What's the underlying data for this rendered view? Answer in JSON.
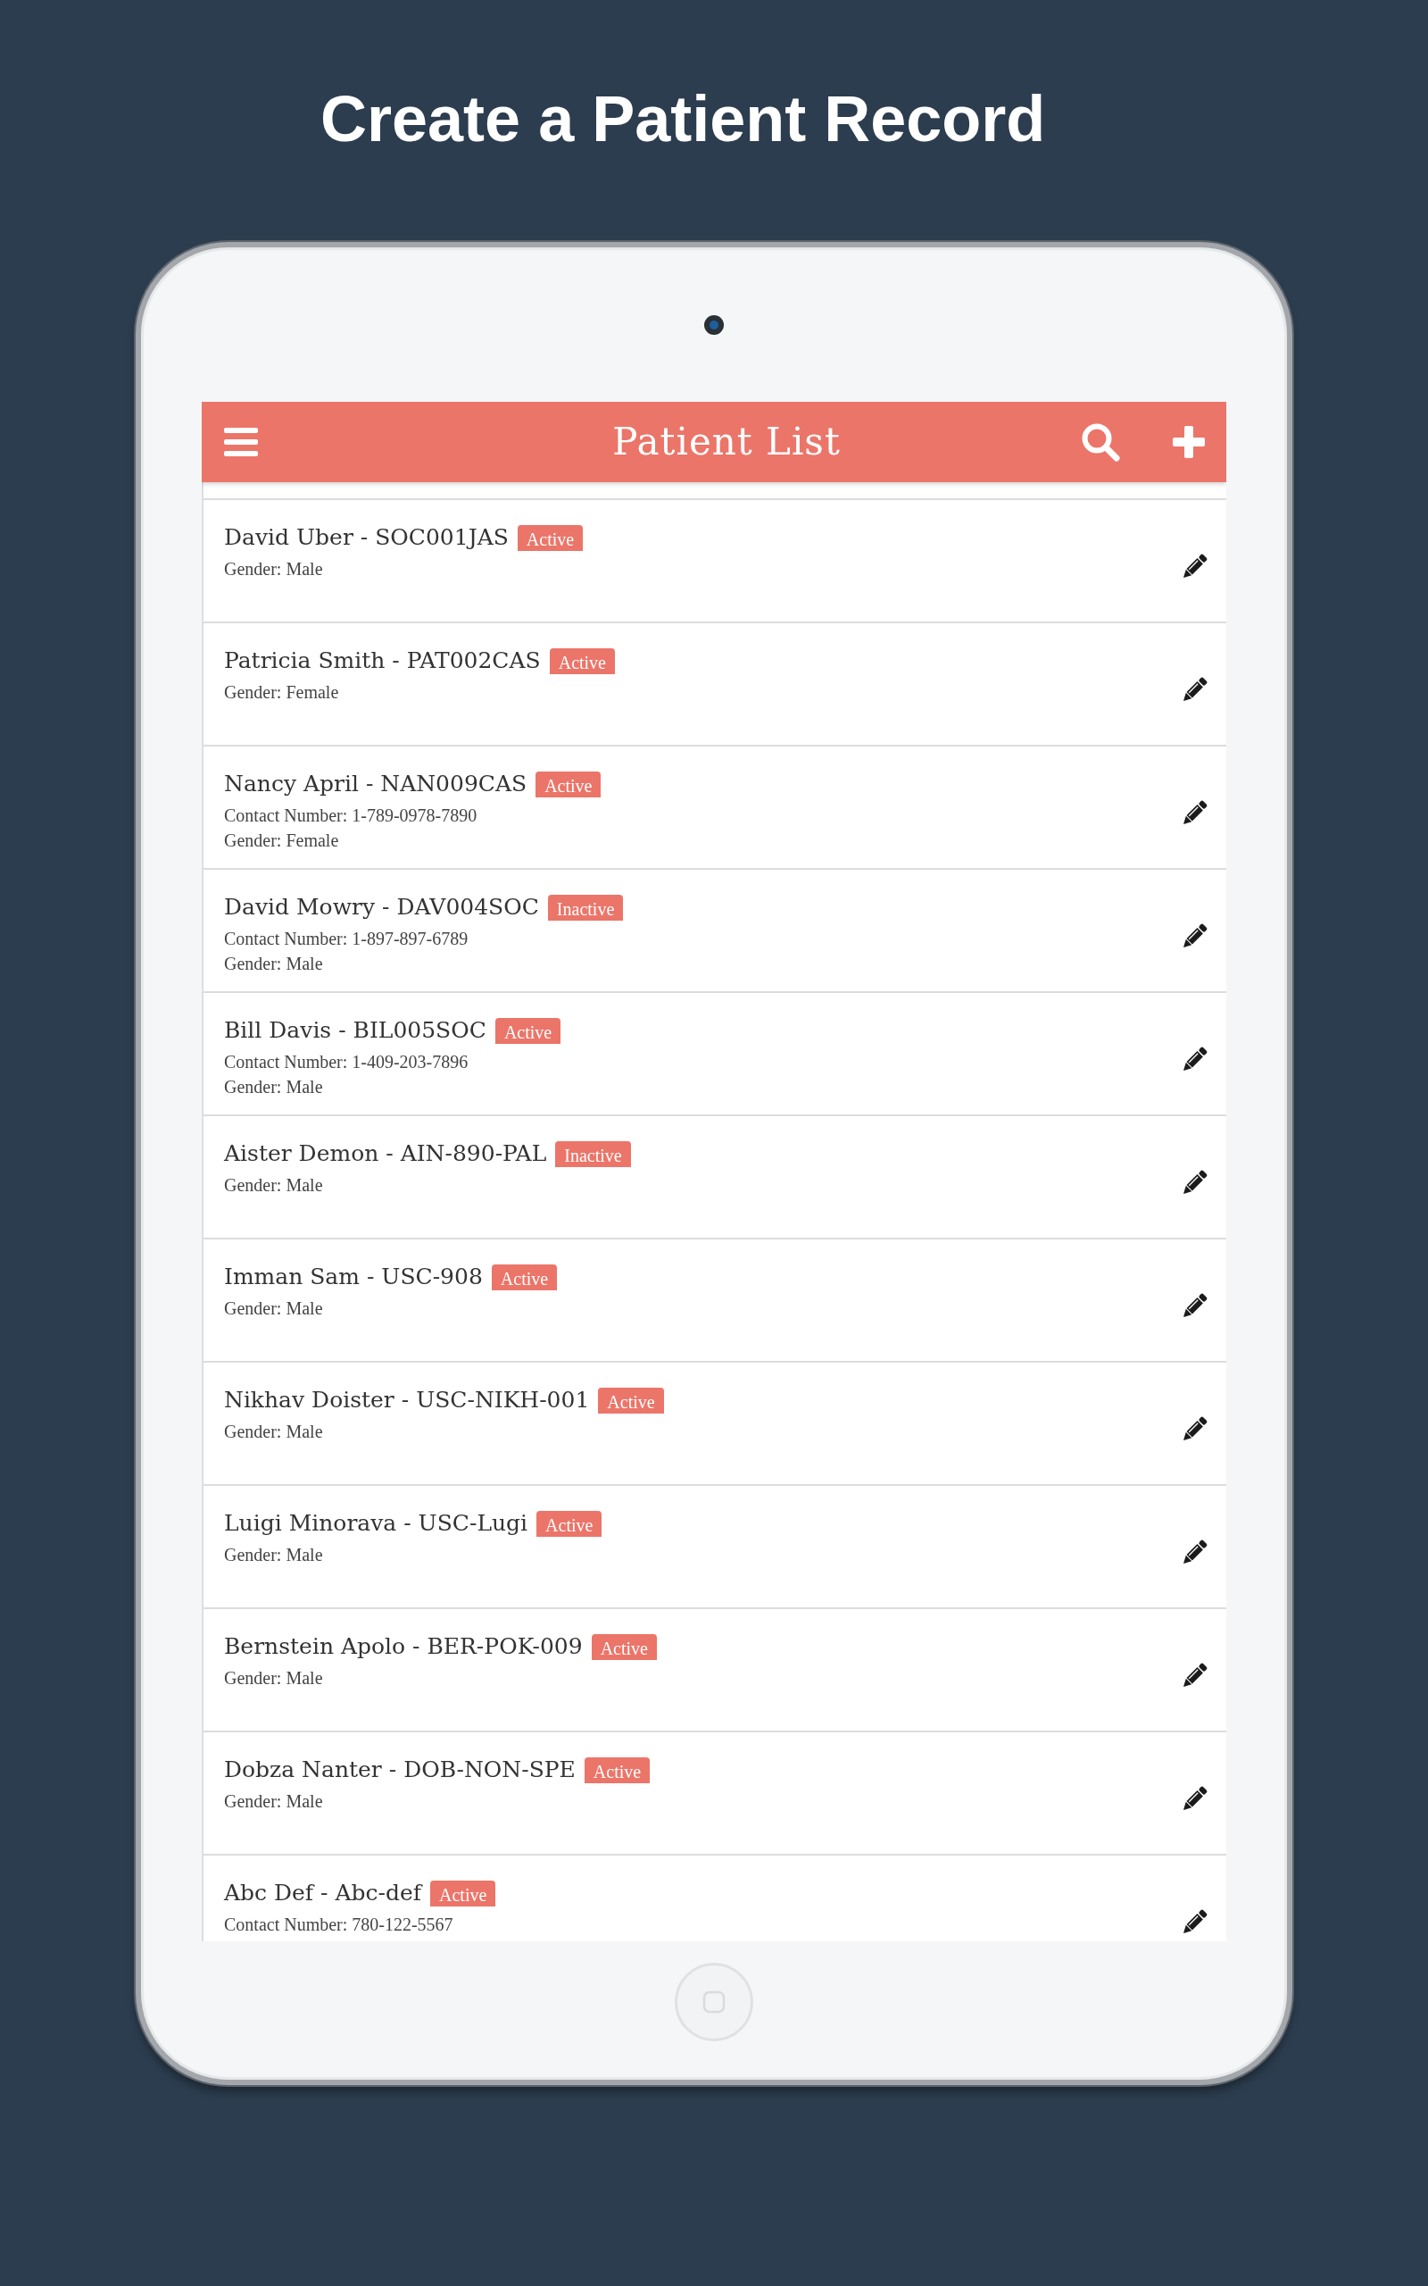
{
  "headline": "Create a Patient Record",
  "app_bar": {
    "title": "Patient List"
  },
  "patients": [
    {
      "name": "David Uber - SOC001JAS",
      "status": "Active",
      "gender": "Gender: Male"
    },
    {
      "name": "Patricia Smith - PAT002CAS",
      "status": "Active",
      "gender": "Gender: Female"
    },
    {
      "name": "Nancy April - NAN009CAS",
      "status": "Active",
      "contact": "Contact Number: 1-789-0978-7890",
      "gender": "Gender: Female"
    },
    {
      "name": "David Mowry - DAV004SOC",
      "status": "Inactive",
      "contact": "Contact Number: 1-897-897-6789",
      "gender": "Gender: Male"
    },
    {
      "name": "Bill Davis - BIL005SOC",
      "status": "Active",
      "contact": "Contact Number: 1-409-203-7896",
      "gender": "Gender: Male"
    },
    {
      "name": "Aister Demon - AIN-890-PAL",
      "status": "Inactive",
      "gender": "Gender: Male"
    },
    {
      "name": "Imman Sam - USC-908",
      "status": "Active",
      "gender": "Gender: Male"
    },
    {
      "name": "Nikhav Doister - USC-NIKH-001",
      "status": "Active",
      "gender": "Gender: Male"
    },
    {
      "name": "Luigi Minorava - USC-Lugi",
      "status": "Active",
      "gender": "Gender: Male"
    },
    {
      "name": "Bernstein Apolo - BER-POK-009",
      "status": "Active",
      "gender": "Gender: Male"
    },
    {
      "name": "Dobza Nanter - DOB-NON-SPE",
      "status": "Active",
      "gender": "Gender: Male"
    },
    {
      "name": "Abc Def - Abc-def",
      "status": "Active",
      "contact": "Contact Number: 780-122-5567"
    }
  ]
}
